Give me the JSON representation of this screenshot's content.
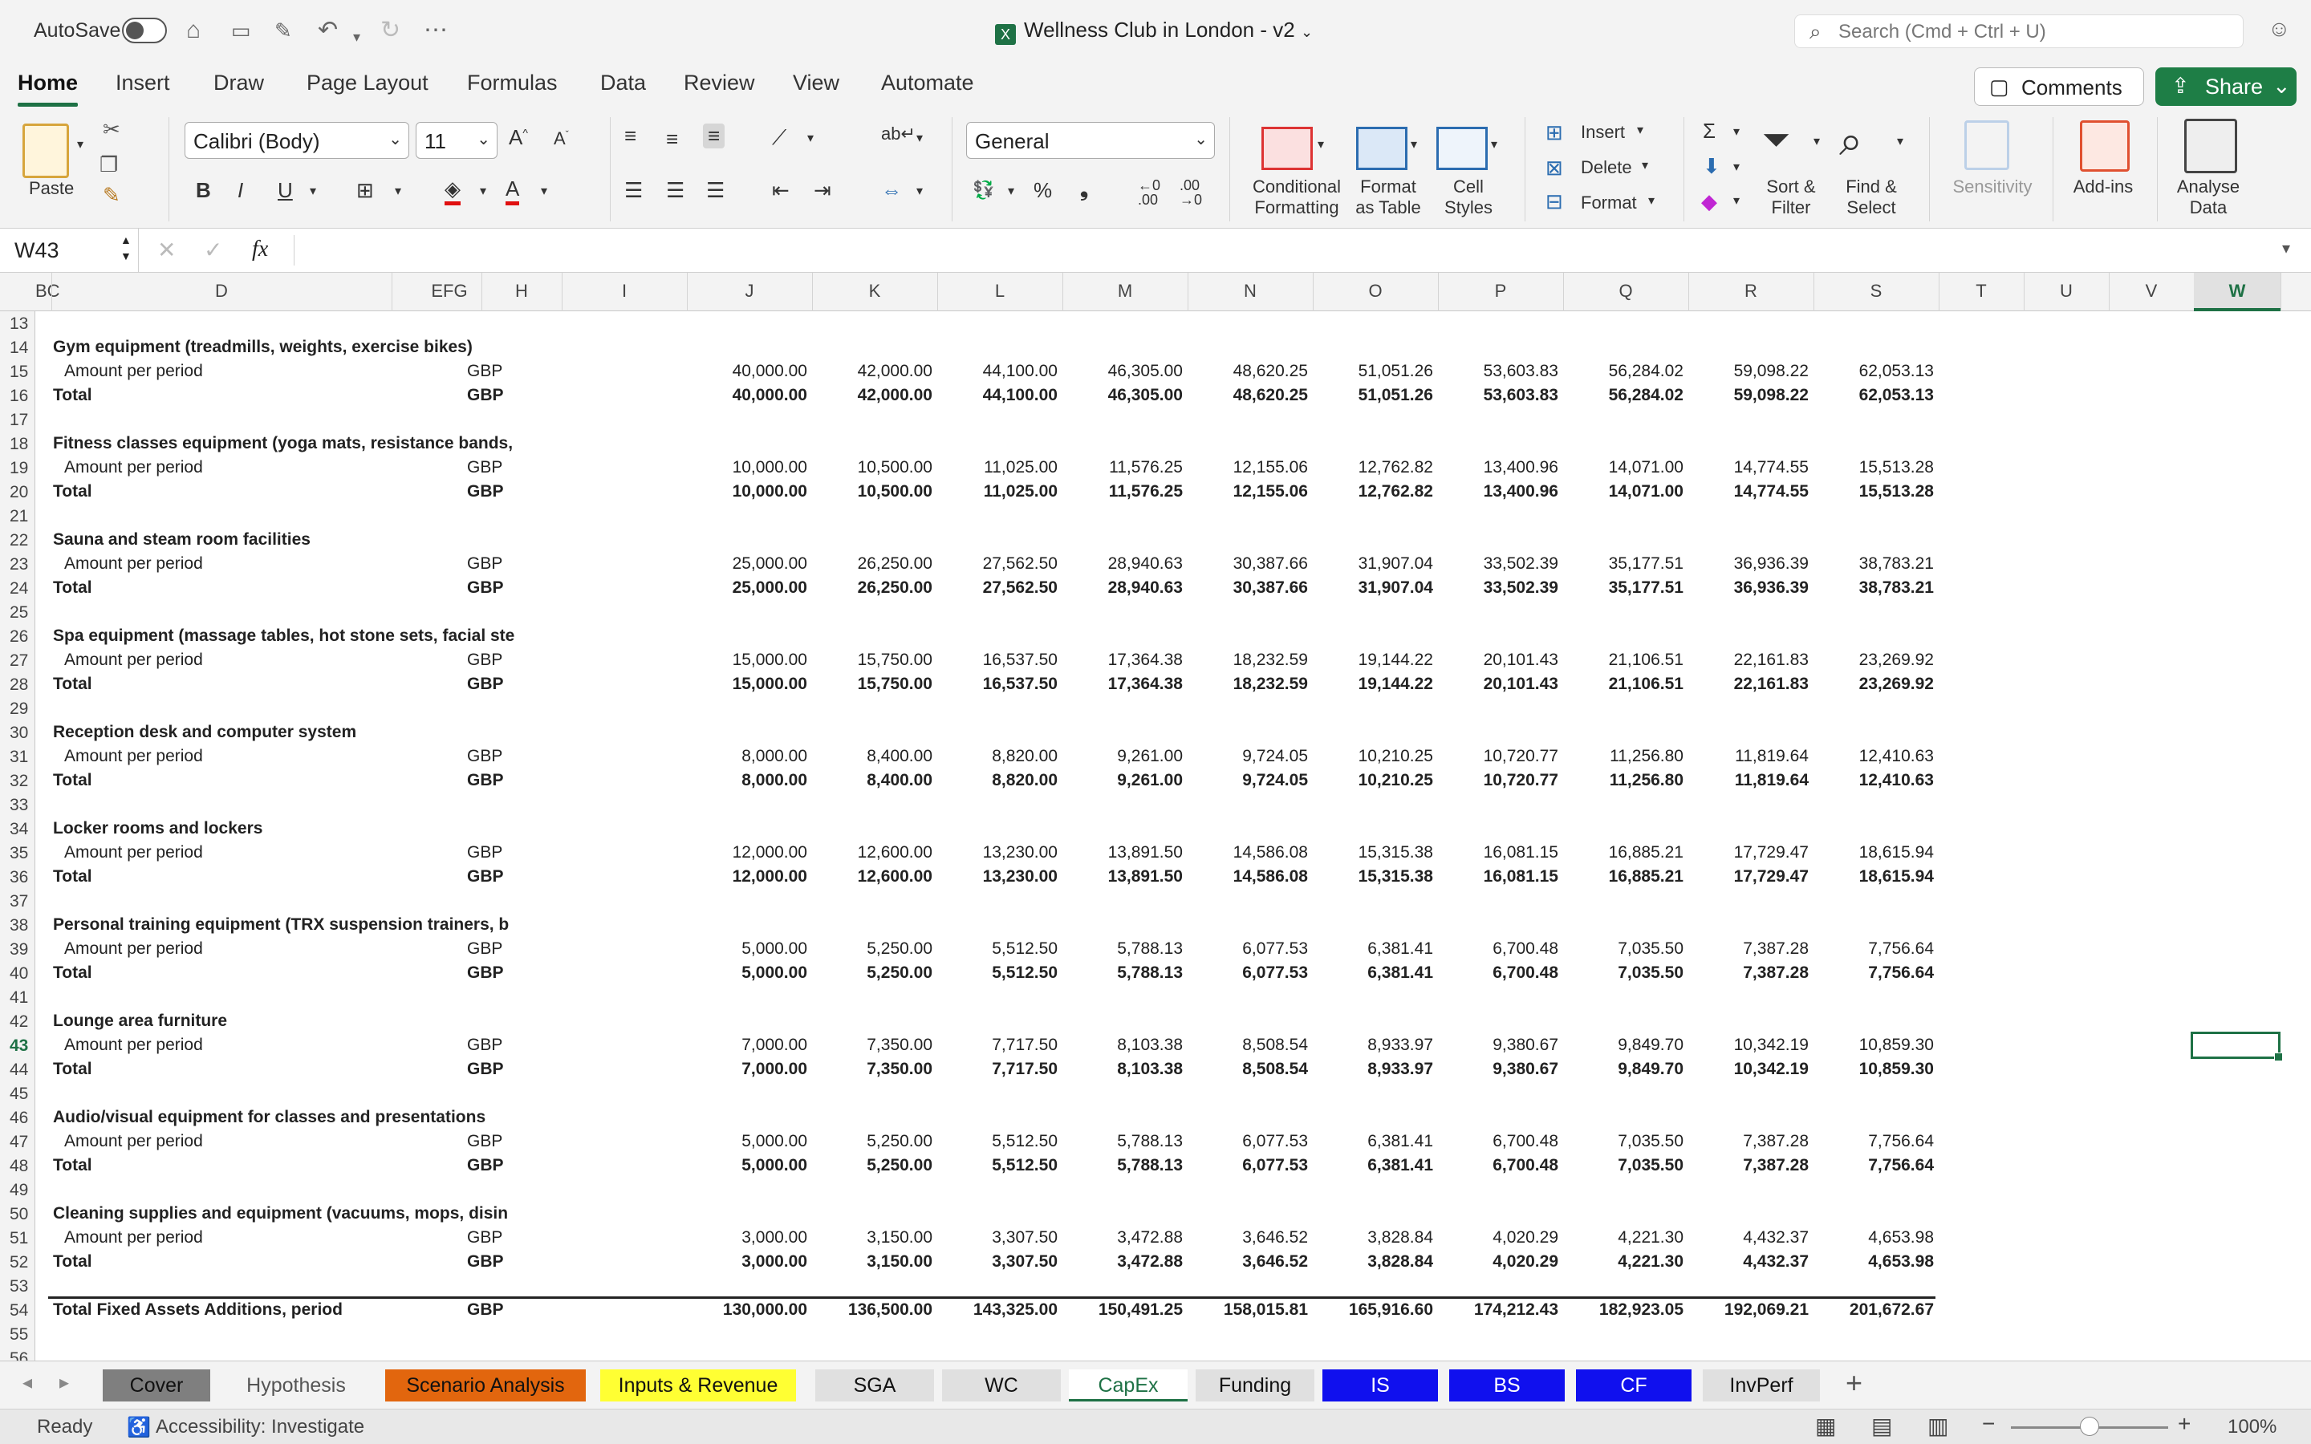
{
  "titlebar": {
    "autosave": "AutoSave",
    "doc_title": "Wellness Club in London - v2",
    "search_placeholder": "Search (Cmd + Ctrl + U)"
  },
  "ribbon_tabs": [
    "Home",
    "Insert",
    "Draw",
    "Page Layout",
    "Formulas",
    "Data",
    "Review",
    "View",
    "Automate"
  ],
  "active_tab": "Home",
  "actions": {
    "comments": "Comments",
    "share": "Share"
  },
  "ribbon": {
    "paste": "Paste",
    "font_name": "Calibri (Body)",
    "font_size": "11",
    "number_format": "General",
    "conditional_formatting": "Conditional\nFormatting",
    "format_as_table": "Format\nas Table",
    "cell_styles": "Cell\nStyles",
    "insert": "Insert",
    "delete": "Delete",
    "format": "Format",
    "sort_filter": "Sort &\nFilter",
    "find_select": "Find &\nSelect",
    "sensitivity": "Sensitivity",
    "addins": "Add-ins",
    "analyse_data": "Analyse\nData"
  },
  "formula_bar": {
    "name_box": "W43",
    "fx": "fx",
    "content": ""
  },
  "columns": [
    "BC",
    "D",
    "EFG",
    "H",
    "I",
    "J",
    "K",
    "L",
    "M",
    "N",
    "O",
    "P",
    "Q",
    "R",
    "S",
    "T",
    "U",
    "V",
    "W"
  ],
  "selected_column": "W",
  "selected_row": "43",
  "rows": [
    {
      "n": "13"
    },
    {
      "n": "14",
      "label": "Gym equipment (treadmills, weights, exercise bikes)",
      "bold": true
    },
    {
      "n": "15",
      "label": "Amount per period",
      "unit": "GBP",
      "values": [
        "40,000.00",
        "42,000.00",
        "44,100.00",
        "46,305.00",
        "48,620.25",
        "51,051.26",
        "53,603.83",
        "56,284.02",
        "59,098.22",
        "62,053.13"
      ]
    },
    {
      "n": "16",
      "label": "Total",
      "unit": "GBP",
      "total": true,
      "values": [
        "40,000.00",
        "42,000.00",
        "44,100.00",
        "46,305.00",
        "48,620.25",
        "51,051.26",
        "53,603.83",
        "56,284.02",
        "59,098.22",
        "62,053.13"
      ]
    },
    {
      "n": "17"
    },
    {
      "n": "18",
      "label": "Fitness classes equipment (yoga mats, resistance bands,",
      "bold": true
    },
    {
      "n": "19",
      "label": "Amount per period",
      "unit": "GBP",
      "values": [
        "10,000.00",
        "10,500.00",
        "11,025.00",
        "11,576.25",
        "12,155.06",
        "12,762.82",
        "13,400.96",
        "14,071.00",
        "14,774.55",
        "15,513.28"
      ]
    },
    {
      "n": "20",
      "label": "Total",
      "unit": "GBP",
      "total": true,
      "values": [
        "10,000.00",
        "10,500.00",
        "11,025.00",
        "11,576.25",
        "12,155.06",
        "12,762.82",
        "13,400.96",
        "14,071.00",
        "14,774.55",
        "15,513.28"
      ]
    },
    {
      "n": "21"
    },
    {
      "n": "22",
      "label": "Sauna and steam room facilities",
      "bold": true
    },
    {
      "n": "23",
      "label": "Amount per period",
      "unit": "GBP",
      "values": [
        "25,000.00",
        "26,250.00",
        "27,562.50",
        "28,940.63",
        "30,387.66",
        "31,907.04",
        "33,502.39",
        "35,177.51",
        "36,936.39",
        "38,783.21"
      ]
    },
    {
      "n": "24",
      "label": "Total",
      "unit": "GBP",
      "total": true,
      "values": [
        "25,000.00",
        "26,250.00",
        "27,562.50",
        "28,940.63",
        "30,387.66",
        "31,907.04",
        "33,502.39",
        "35,177.51",
        "36,936.39",
        "38,783.21"
      ]
    },
    {
      "n": "25"
    },
    {
      "n": "26",
      "label": "Spa equipment (massage tables, hot stone sets, facial ste",
      "bold": true
    },
    {
      "n": "27",
      "label": "Amount per period",
      "unit": "GBP",
      "values": [
        "15,000.00",
        "15,750.00",
        "16,537.50",
        "17,364.38",
        "18,232.59",
        "19,144.22",
        "20,101.43",
        "21,106.51",
        "22,161.83",
        "23,269.92"
      ]
    },
    {
      "n": "28",
      "label": "Total",
      "unit": "GBP",
      "total": true,
      "values": [
        "15,000.00",
        "15,750.00",
        "16,537.50",
        "17,364.38",
        "18,232.59",
        "19,144.22",
        "20,101.43",
        "21,106.51",
        "22,161.83",
        "23,269.92"
      ]
    },
    {
      "n": "29"
    },
    {
      "n": "30",
      "label": "Reception desk and computer system",
      "bold": true
    },
    {
      "n": "31",
      "label": "Amount per period",
      "unit": "GBP",
      "values": [
        "8,000.00",
        "8,400.00",
        "8,820.00",
        "9,261.00",
        "9,724.05",
        "10,210.25",
        "10,720.77",
        "11,256.80",
        "11,819.64",
        "12,410.63"
      ]
    },
    {
      "n": "32",
      "label": "Total",
      "unit": "GBP",
      "total": true,
      "values": [
        "8,000.00",
        "8,400.00",
        "8,820.00",
        "9,261.00",
        "9,724.05",
        "10,210.25",
        "10,720.77",
        "11,256.80",
        "11,819.64",
        "12,410.63"
      ]
    },
    {
      "n": "33"
    },
    {
      "n": "34",
      "label": "Locker rooms and lockers",
      "bold": true
    },
    {
      "n": "35",
      "label": "Amount per period",
      "unit": "GBP",
      "values": [
        "12,000.00",
        "12,600.00",
        "13,230.00",
        "13,891.50",
        "14,586.08",
        "15,315.38",
        "16,081.15",
        "16,885.21",
        "17,729.47",
        "18,615.94"
      ]
    },
    {
      "n": "36",
      "label": "Total",
      "unit": "GBP",
      "total": true,
      "values": [
        "12,000.00",
        "12,600.00",
        "13,230.00",
        "13,891.50",
        "14,586.08",
        "15,315.38",
        "16,081.15",
        "16,885.21",
        "17,729.47",
        "18,615.94"
      ]
    },
    {
      "n": "37"
    },
    {
      "n": "38",
      "label": "Personal training equipment (TRX suspension trainers, b",
      "bold": true
    },
    {
      "n": "39",
      "label": "Amount per period",
      "unit": "GBP",
      "values": [
        "5,000.00",
        "5,250.00",
        "5,512.50",
        "5,788.13",
        "6,077.53",
        "6,381.41",
        "6,700.48",
        "7,035.50",
        "7,387.28",
        "7,756.64"
      ]
    },
    {
      "n": "40",
      "label": "Total",
      "unit": "GBP",
      "total": true,
      "values": [
        "5,000.00",
        "5,250.00",
        "5,512.50",
        "5,788.13",
        "6,077.53",
        "6,381.41",
        "6,700.48",
        "7,035.50",
        "7,387.28",
        "7,756.64"
      ]
    },
    {
      "n": "41"
    },
    {
      "n": "42",
      "label": "Lounge area furniture",
      "bold": true
    },
    {
      "n": "43",
      "label": "Amount per period",
      "unit": "GBP",
      "values": [
        "7,000.00",
        "7,350.00",
        "7,717.50",
        "8,103.38",
        "8,508.54",
        "8,933.97",
        "9,380.67",
        "9,849.70",
        "10,342.19",
        "10,859.30"
      ]
    },
    {
      "n": "44",
      "label": "Total",
      "unit": "GBP",
      "total": true,
      "values": [
        "7,000.00",
        "7,350.00",
        "7,717.50",
        "8,103.38",
        "8,508.54",
        "8,933.97",
        "9,380.67",
        "9,849.70",
        "10,342.19",
        "10,859.30"
      ]
    },
    {
      "n": "45"
    },
    {
      "n": "46",
      "label": "Audio/visual equipment for classes and presentations",
      "bold": true
    },
    {
      "n": "47",
      "label": "Amount per period",
      "unit": "GBP",
      "values": [
        "5,000.00",
        "5,250.00",
        "5,512.50",
        "5,788.13",
        "6,077.53",
        "6,381.41",
        "6,700.48",
        "7,035.50",
        "7,387.28",
        "7,756.64"
      ]
    },
    {
      "n": "48",
      "label": "Total",
      "unit": "GBP",
      "total": true,
      "values": [
        "5,000.00",
        "5,250.00",
        "5,512.50",
        "5,788.13",
        "6,077.53",
        "6,381.41",
        "6,700.48",
        "7,035.50",
        "7,387.28",
        "7,756.64"
      ]
    },
    {
      "n": "49"
    },
    {
      "n": "50",
      "label": "Cleaning supplies and equipment (vacuums, mops, disin",
      "bold": true
    },
    {
      "n": "51",
      "label": "Amount per period",
      "unit": "GBP",
      "values": [
        "3,000.00",
        "3,150.00",
        "3,307.50",
        "3,472.88",
        "3,646.52",
        "3,828.84",
        "4,020.29",
        "4,221.30",
        "4,432.37",
        "4,653.98"
      ]
    },
    {
      "n": "52",
      "label": "Total",
      "unit": "GBP",
      "total": true,
      "values": [
        "3,000.00",
        "3,150.00",
        "3,307.50",
        "3,472.88",
        "3,646.52",
        "3,828.84",
        "4,020.29",
        "4,221.30",
        "4,432.37",
        "4,653.98"
      ]
    },
    {
      "n": "53"
    },
    {
      "n": "54",
      "label": "Total Fixed Assets Additions, period",
      "unit": "GBP",
      "total": true,
      "grand": true,
      "values": [
        "130,000.00",
        "136,500.00",
        "143,325.00",
        "150,491.25",
        "158,015.81",
        "165,916.60",
        "174,212.43",
        "182,923.05",
        "192,069.21",
        "201,672.67"
      ]
    },
    {
      "n": "55"
    },
    {
      "n": "56"
    }
  ],
  "sheet_tabs": [
    {
      "name": "Cover",
      "bg": "#7f7f7f",
      "fg": "#111"
    },
    {
      "name": "Hypothesis",
      "bg": "#f3f3f3",
      "fg": "#555"
    },
    {
      "name": "Scenario Analysis",
      "bg": "#e2660e",
      "fg": "#111"
    },
    {
      "name": "Inputs & Revenue",
      "bg": "#ffff33",
      "fg": "#111"
    },
    {
      "name": "SGA",
      "bg": "#e0e0e0",
      "fg": "#111"
    },
    {
      "name": "WC",
      "bg": "#e0e0e0",
      "fg": "#111"
    },
    {
      "name": "CapEx",
      "bg": "#ffffff",
      "fg": "#1e7145",
      "active": true
    },
    {
      "name": "Funding",
      "bg": "#e0e0e0",
      "fg": "#111"
    },
    {
      "name": "IS",
      "bg": "#1010ee",
      "fg": "#fff"
    },
    {
      "name": "BS",
      "bg": "#1010ee",
      "fg": "#fff"
    },
    {
      "name": "CF",
      "bg": "#1010ee",
      "fg": "#fff"
    },
    {
      "name": "InvPerf",
      "bg": "#e0e0e0",
      "fg": "#111"
    }
  ],
  "status": {
    "ready": "Ready",
    "accessibility": "Accessibility: Investigate",
    "zoom": "100%"
  }
}
